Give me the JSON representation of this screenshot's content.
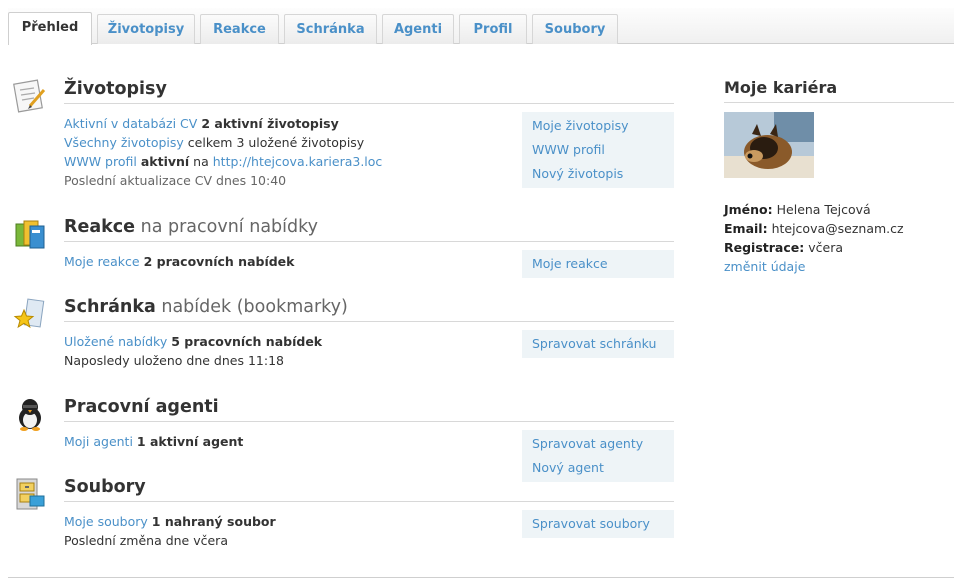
{
  "tabs": [
    "Přehled",
    "Životopisy",
    "Reakce",
    "Schránka",
    "Agenti",
    "Profil",
    "Soubory"
  ],
  "resumes": {
    "title": "Životopisy",
    "line1_link": "Aktivní v databázi CV",
    "line1_value": "2 aktivní životopisy",
    "line2_link": "Všechny životopisy",
    "line2_text": "celkem 3 uložené životopisy",
    "line3_link": "WWW profil",
    "line3_value": "aktivní",
    "line3_text": "na",
    "line3_url": "http://htejcova.kariera3.loc",
    "line4_text": "Poslední aktualizace CV dnes 10:40",
    "actions": [
      "Moje životopisy",
      "WWW profil",
      "Nový životopis"
    ]
  },
  "reactions": {
    "title": "Reakce",
    "subtitle": "na pracovní nabídky",
    "line1_link": "Moje reakce",
    "line1_value": "2 pracovních nabídek",
    "actions": [
      "Moje reakce"
    ]
  },
  "bookmarks": {
    "title": "Schránka",
    "subtitle": "nabídek (bookmarky)",
    "line1_link": "Uložené nabídky",
    "line1_value": "5 pracovních nabídek",
    "line2_text": "Naposledy uloženo dne dnes 11:18",
    "actions": [
      "Spravovat schránku"
    ]
  },
  "agents": {
    "title": "Pracovní agenti",
    "line1_link": "Moji agenti",
    "line1_value": "1 aktivní agent",
    "actions": [
      "Spravovat agenty",
      "Nový agent"
    ]
  },
  "files": {
    "title": "Soubory",
    "line1_link": "Moje soubory",
    "line1_value": "1 nahraný soubor",
    "line2_text": "Poslední změna dne včera",
    "actions": [
      "Spravovat soubory"
    ]
  },
  "sidebar": {
    "title": "Moje kariéra",
    "name_label": "Jméno:",
    "name_value": "Helena Tejcová",
    "email_label": "Email:",
    "email_value": "htejcova@seznam.cz",
    "registration_label": "Registrace:",
    "registration_value": "včera",
    "edit_link": "změnit údaje"
  },
  "icons": {
    "resumes": "document-pen-icon",
    "reactions": "folders-icon",
    "bookmarks": "star-bookmark-icon",
    "agents": "agent-penguin-icon",
    "files": "file-cabinet-icon"
  },
  "colors": {
    "link": "#4a90c8",
    "action_bg": "#eef4f7",
    "tab_active_text": "#333333"
  }
}
